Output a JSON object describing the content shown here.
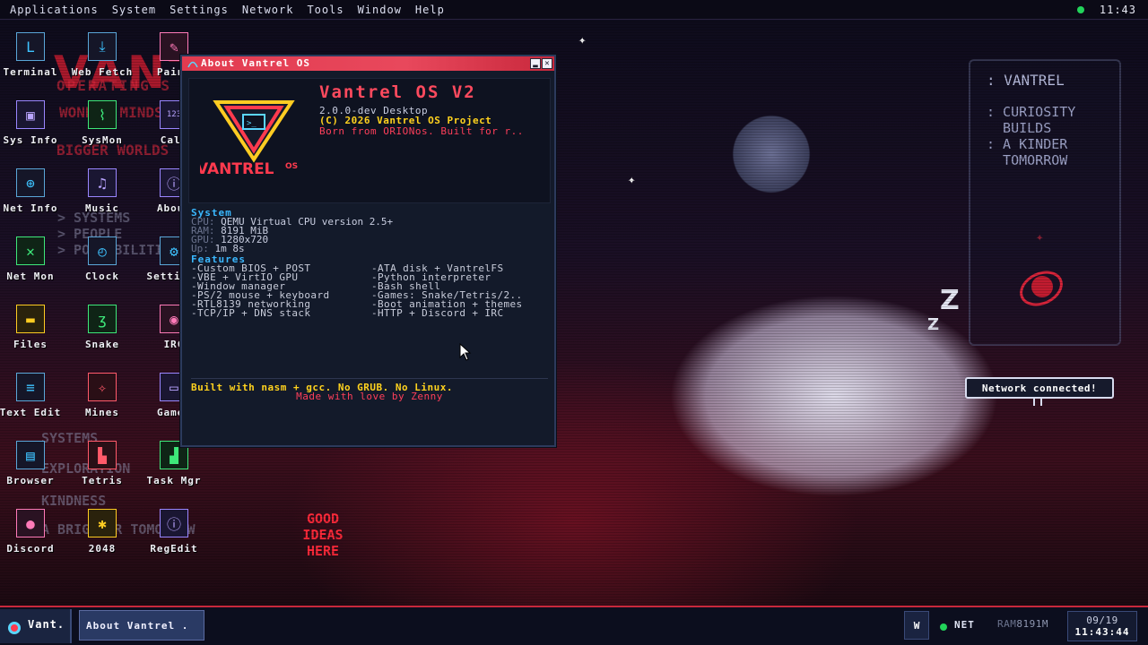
{
  "menubar": {
    "items": [
      "Applications",
      "System",
      "Settings",
      "Network",
      "Tools",
      "Window",
      "Help"
    ],
    "clock": "11:43"
  },
  "wallpaper": {
    "logo": "VANTREL",
    "subtitle": "OPERATING S",
    "tagline_1": "BIGGER WORLDS",
    "tagline_2": "WONDER MINDS",
    "gray_1": "> SYSTEMS",
    "gray_2": "> PEOPLE",
    "gray_3": "> POSSIBILITIES",
    "gray_4": "SYSTEMS",
    "gray_5": "EXPLORATION",
    "gray_6": "KINDNESS",
    "gray_7": "A BRIGHTER TOMORROW",
    "panel_title": ": VANTREL",
    "panel_lines": ": CURIOSITY\n  BUILDS\n: A KINDER\n  TOMORROW",
    "sign": "GOOD\nIDEAS\nHERE",
    "zzz": "Z"
  },
  "desktop_icons": [
    {
      "label": "Terminal",
      "icon": "terminal-icon",
      "glyph": "L"
    },
    {
      "label": "Web Fetch",
      "icon": "download-icon",
      "glyph": "⤓"
    },
    {
      "label": "Paint",
      "icon": "paint-icon",
      "glyph": "✎"
    },
    {
      "label": "Sys Info",
      "icon": "chip-icon",
      "glyph": "▣"
    },
    {
      "label": "SysMon",
      "icon": "monitor-graph-icon",
      "glyph": "⌇"
    },
    {
      "label": "Calc",
      "icon": "calculator-icon",
      "glyph": "123"
    },
    {
      "label": "Net Info",
      "icon": "globe-icon",
      "glyph": "⊕"
    },
    {
      "label": "Music",
      "icon": "music-icon",
      "glyph": "♫"
    },
    {
      "label": "About",
      "icon": "info-icon",
      "glyph": "ⓘ"
    },
    {
      "label": "Net Mon",
      "icon": "network-monitor-icon",
      "glyph": "✕"
    },
    {
      "label": "Clock",
      "icon": "clock-icon",
      "glyph": "◴"
    },
    {
      "label": "Settings",
      "icon": "gear-icon",
      "glyph": "⚙"
    },
    {
      "label": "Files",
      "icon": "folder-icon",
      "glyph": "▬"
    },
    {
      "label": "Snake",
      "icon": "snake-icon",
      "glyph": "ʒ"
    },
    {
      "label": "IRC",
      "icon": "chat-icon",
      "glyph": "◉"
    },
    {
      "label": "Text Edit",
      "icon": "document-icon",
      "glyph": "≡"
    },
    {
      "label": "Mines",
      "icon": "mine-icon",
      "glyph": "✧"
    },
    {
      "label": "Games",
      "icon": "gamepad-icon",
      "glyph": "▭"
    },
    {
      "label": "Browser",
      "icon": "browser-icon",
      "glyph": "▤"
    },
    {
      "label": "Tetris",
      "icon": "tetris-icon",
      "glyph": "▙"
    },
    {
      "label": "Task Mgr",
      "icon": "bar-chart-icon",
      "glyph": "▟"
    },
    {
      "label": "Discord",
      "icon": "discord-icon",
      "glyph": "●"
    },
    {
      "label": "2048",
      "icon": "puzzle-icon",
      "glyph": "✱"
    },
    {
      "label": "RegEdit",
      "icon": "info-circle-icon",
      "glyph": "ⓘ"
    }
  ],
  "about_window": {
    "title": "About Vantrel OS",
    "logo_text": "VANTREL",
    "logo_os": "OS",
    "heading": "Vantrel OS V2",
    "version": "2.0.0-dev Desktop",
    "copyright": "(C) 2026 Vantrel OS Project",
    "tagline": "Born from ORIONos. Built for r..",
    "system_header": "System",
    "specs": [
      {
        "key": "CPU:",
        "value": "QEMU Virtual CPU version 2.5+"
      },
      {
        "key": "RAM:",
        "value": "8191 MiB"
      },
      {
        "key": "GPU:",
        "value": "1280x720"
      },
      {
        "key": "Up:",
        "value": "1m 8s"
      }
    ],
    "features_header": "Features",
    "features_left": [
      "-Custom BIOS + POST",
      "-VBE + VirtIO GPU",
      "-Window manager",
      "-PS/2 mouse + keyboard",
      "-RTL8139 networking",
      "-TCP/IP + DNS stack"
    ],
    "features_right": [
      "-ATA disk + VantrelFS",
      "-Python interpreter",
      "-Bash shell",
      "-Games: Snake/Tetris/2..",
      "-Boot animation + themes",
      "-HTTP + Discord + IRC"
    ],
    "built_line": "Built with nasm + gcc. No GRUB. No Linux.",
    "made_line": "Made with love by Zenny"
  },
  "notification": {
    "text": "Network connected!"
  },
  "taskbar": {
    "start_label": "Vant.",
    "task_label": "About Vantrel .",
    "tray_w": "W",
    "net_label": "NET",
    "ram_key": "RAM",
    "ram_value": "8191M",
    "date": "09/19",
    "time": "11:43:44"
  },
  "colors": {
    "accent": "#e23b50",
    "link_blue": "#3ab8ff",
    "highlight_yellow": "#ffd21e",
    "status_green": "#22d35a"
  }
}
